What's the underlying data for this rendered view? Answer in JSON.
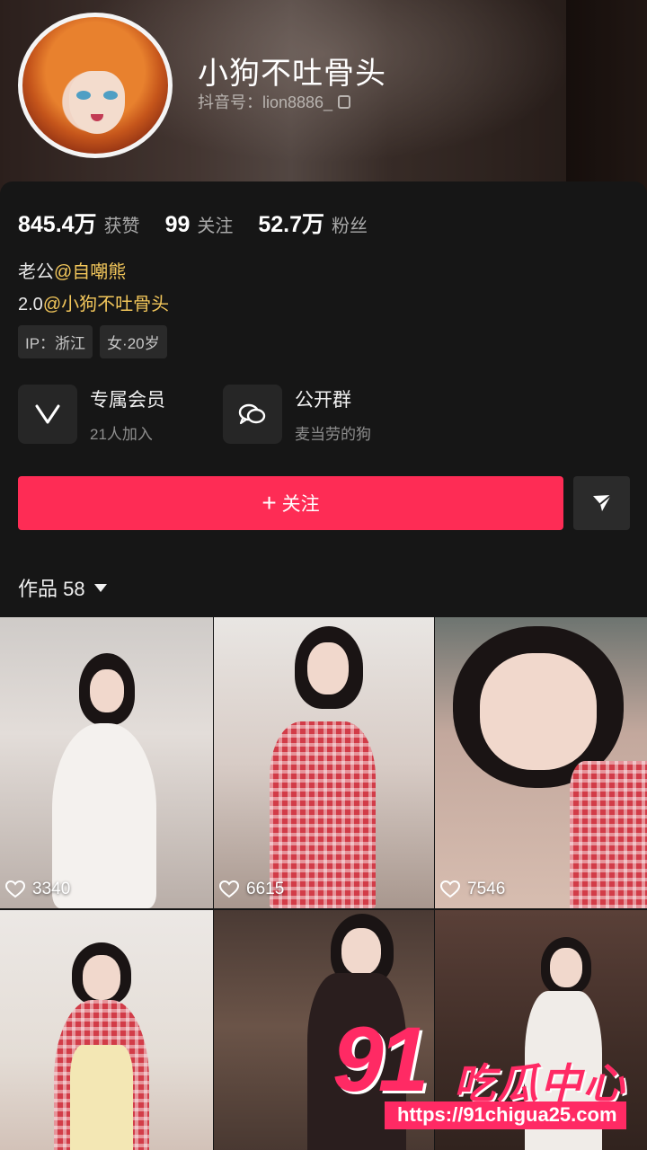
{
  "profile": {
    "nickname": "小狗不吐骨头",
    "handle": "抖音号：lion8886_"
  },
  "stats": [
    {
      "value": "845.4万",
      "label": "获赞"
    },
    {
      "value": "99",
      "label": "关注"
    },
    {
      "value": "52.7万",
      "label": "粉丝"
    }
  ],
  "bio": {
    "line1_prefix": "老公",
    "line1_mention": "@自嘲熊",
    "line2_prefix": "2.0",
    "line2_mention": "@小狗不吐骨头"
  },
  "tags": [
    "IP：浙江",
    "女·20岁"
  ],
  "features": {
    "member_title": "专属会员",
    "member_sub": "21人加入",
    "group_title": "公开群",
    "group_sub": "麦当劳的狗"
  },
  "actions": {
    "follow_plus": "+",
    "follow_label": "关注"
  },
  "works": {
    "label": "作品 58"
  },
  "grid_items": [
    {
      "likes": "3340"
    },
    {
      "likes": "6615"
    },
    {
      "likes": "7546"
    },
    {
      "likes": ""
    },
    {
      "likes": ""
    },
    {
      "likes": ""
    }
  ],
  "watermark": {
    "number": "91",
    "name": "吃瓜中心",
    "url": "https://91chigua25.com"
  },
  "colors": {
    "accent": "#fe2c55",
    "mention": "#f3c75b",
    "background": "#161616"
  }
}
